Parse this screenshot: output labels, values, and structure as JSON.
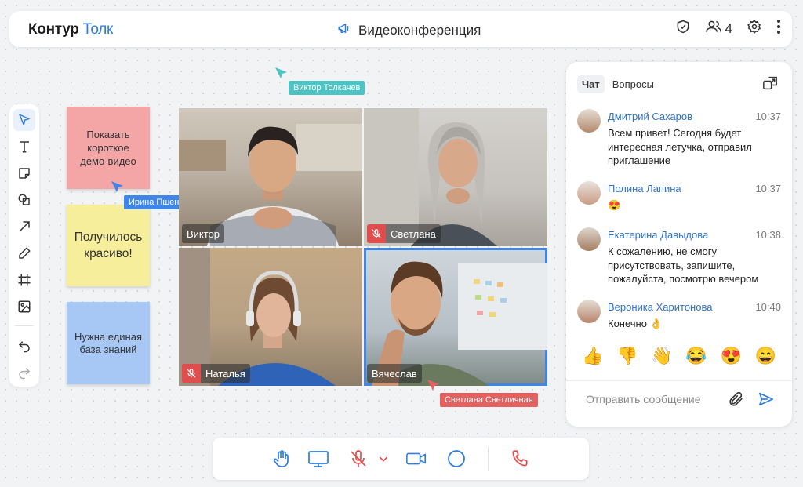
{
  "app": {
    "logo_part1": "Контур",
    "logo_part2": "Толк",
    "title": "Видеоконференция",
    "participants_count": "4"
  },
  "cursors": {
    "viktor": "Виктор Толкачев",
    "irina": "Ирина Пшеничная",
    "svetlana": "Светлана Светличная"
  },
  "tools": [
    "pointer-tool",
    "text-tool",
    "sticky-tool",
    "shapes-tool",
    "arrow-tool",
    "pen-tool",
    "frame-tool",
    "image-tool",
    "undo",
    "redo"
  ],
  "stickies": {
    "s1": "Показать короткое демо-видео",
    "s2": "Получилось красиво!",
    "s3": "Нужна единая база знаний"
  },
  "videos": [
    {
      "name": "Виктор",
      "muted": false
    },
    {
      "name": "Светлана",
      "muted": true
    },
    {
      "name": "Наталья",
      "muted": true
    },
    {
      "name": "Вячеслав",
      "muted": false,
      "active": true
    }
  ],
  "chat": {
    "tab_chat": "Чат",
    "tab_questions": "Вопросы",
    "messages": [
      {
        "author": "Дмитрий Сахаров",
        "time": "10:37",
        "text": "Всем привет! Сегодня будет интересная летучка, отправил приглашение"
      },
      {
        "author": "Полина Лапина",
        "time": "10:37",
        "text": "😍"
      },
      {
        "author": "Екатерина Давыдова",
        "time": "10:38",
        "text": "К сожалению, не смогу присутствовать, запишите, пожалуйста, посмотрю вечером"
      },
      {
        "author": "Вероника Харитонова",
        "time": "10:40",
        "text": "Конечно 👌"
      }
    ],
    "reactions": [
      "👍",
      "👎",
      "👋",
      "😂",
      "😍",
      "😄"
    ],
    "input_placeholder": "Отправить сообщение"
  },
  "colors": {
    "accent": "#2f7de1",
    "danger": "#e14d4d",
    "cursor_teal": "#4ec3c3",
    "cursor_blue": "#3f86e8",
    "cursor_red": "#e66060"
  }
}
